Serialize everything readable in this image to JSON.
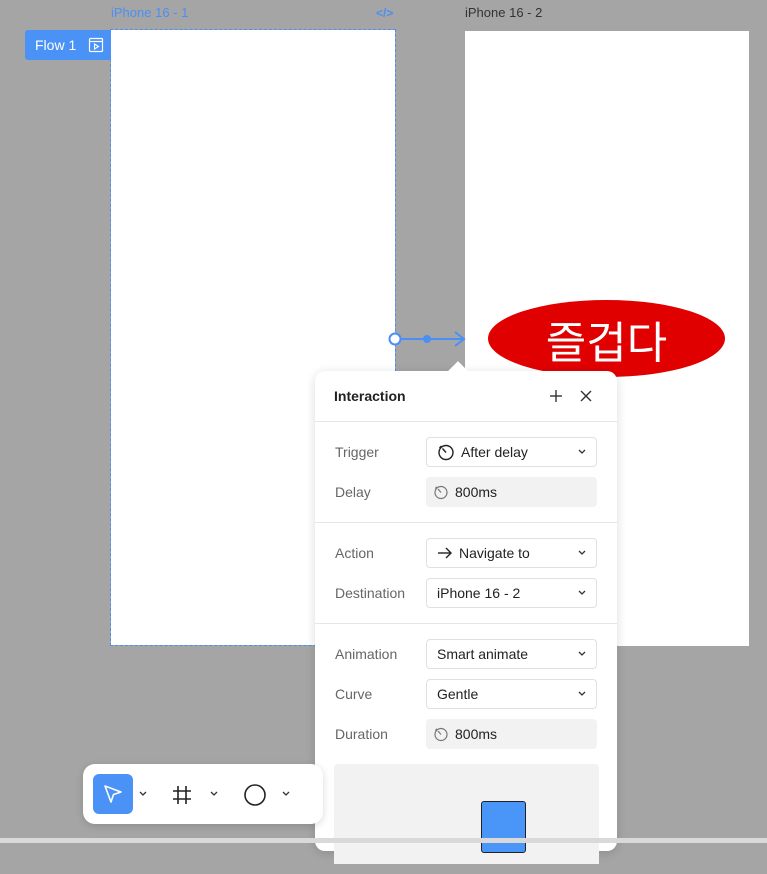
{
  "canvas": {
    "frame1_label": "iPhone 16 - 1",
    "frame2_label": "iPhone 16 - 2",
    "flow_badge": "Flow 1",
    "annotation_text": "즐겁다",
    "colors": {
      "background": "#a5a5a5",
      "selection": "#4a8ff5",
      "annotation": "#e00000"
    }
  },
  "interaction_panel": {
    "title": "Interaction",
    "trigger": {
      "label": "Trigger",
      "value": "After delay"
    },
    "delay": {
      "label": "Delay",
      "value": "800ms"
    },
    "action": {
      "label": "Action",
      "value": "Navigate to"
    },
    "destination": {
      "label": "Destination",
      "value": "iPhone 16 - 2"
    },
    "animation": {
      "label": "Animation",
      "value": "Smart animate"
    },
    "curve": {
      "label": "Curve",
      "value": "Gentle"
    },
    "duration": {
      "label": "Duration",
      "value": "800ms"
    }
  },
  "toolbar": {
    "tools": [
      "move-tool",
      "frame-tool",
      "ellipse-tool"
    ],
    "active": "move-tool"
  }
}
